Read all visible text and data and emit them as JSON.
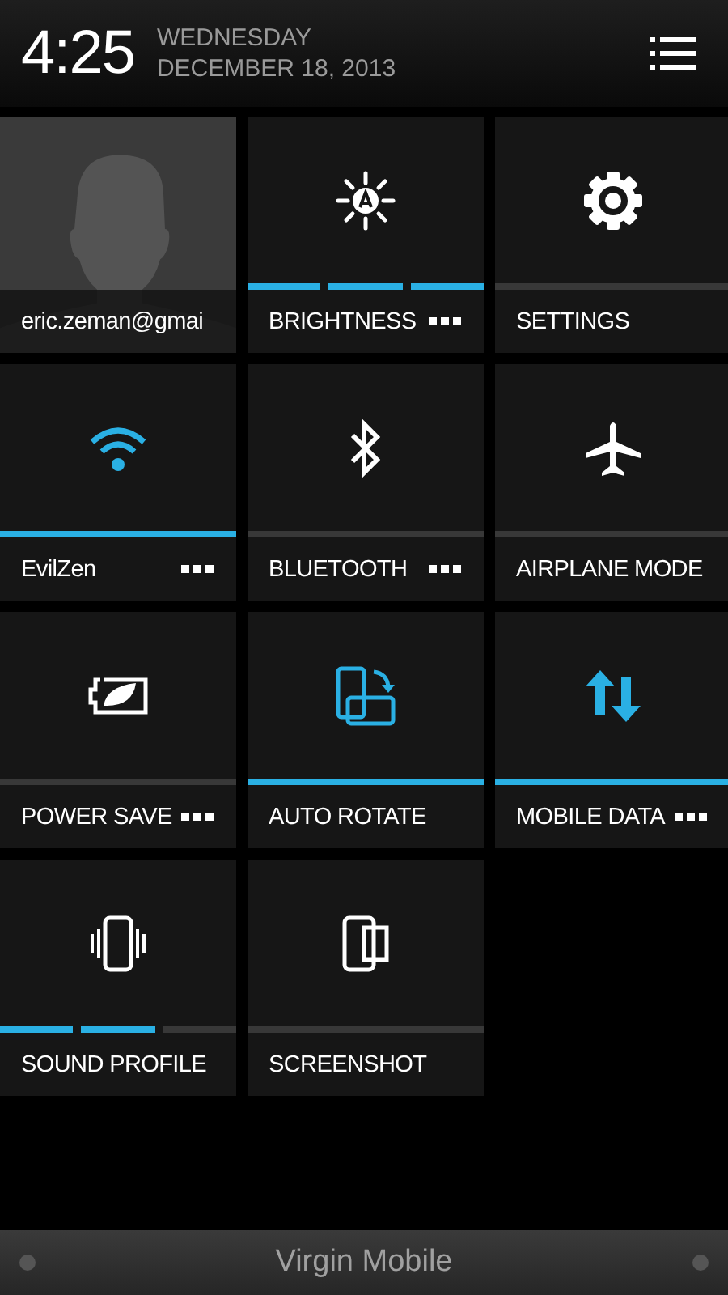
{
  "header": {
    "time": "4:25",
    "day": "WEDNESDAY",
    "date": "DECEMBER 18, 2013"
  },
  "tiles": [
    {
      "kind": "account",
      "label": "eric.zeman@gmai"
    },
    {
      "kind": "segments",
      "label": "BRIGHTNESS",
      "segments": [
        {
          "lit": true
        },
        {
          "lit": true
        },
        {
          "lit": true
        }
      ],
      "more": true
    },
    {
      "kind": "toggle",
      "label": "SETTINGS",
      "on": false,
      "more": false
    },
    {
      "kind": "toggle",
      "label": "EvilZen",
      "on": true,
      "more": true
    },
    {
      "kind": "toggle",
      "label": "BLUETOOTH",
      "on": false,
      "more": true
    },
    {
      "kind": "toggle",
      "label": "AIRPLANE MODE",
      "on": false,
      "more": false
    },
    {
      "kind": "toggle",
      "label": "POWER SAVE",
      "on": false,
      "more": true
    },
    {
      "kind": "toggle",
      "label": "AUTO ROTATE",
      "on": true,
      "more": false
    },
    {
      "kind": "toggle",
      "label": "MOBILE DATA",
      "on": true,
      "more": true
    },
    {
      "kind": "segments",
      "label": "SOUND PROFILE",
      "segments": [
        {
          "lit": true
        },
        {
          "lit": true
        },
        {
          "lit": false
        }
      ],
      "more": false
    },
    {
      "kind": "toggle",
      "label": "SCREENSHOT",
      "on": false,
      "more": false
    }
  ],
  "carrier": "Virgin Mobile"
}
